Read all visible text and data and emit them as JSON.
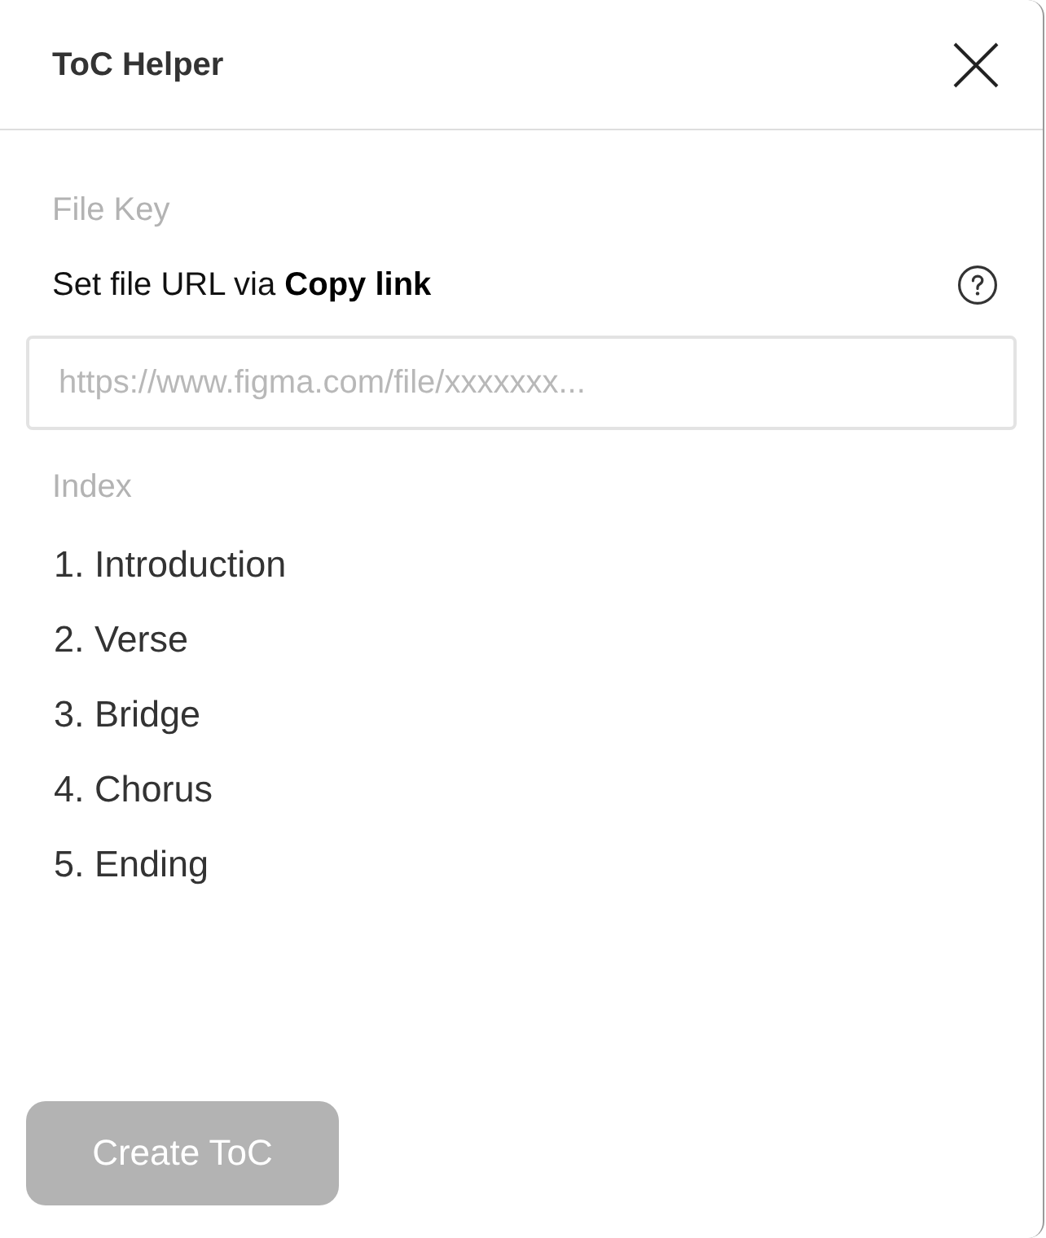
{
  "window": {
    "title": "ToC Helper"
  },
  "file_key": {
    "label": "File Key",
    "instruction": "Set file URL via **Copy link**",
    "url_field": {
      "placeholder": "https://www.figma.com/file/xxxxxxx..."
    }
  },
  "index": {
    "label": "Index",
    "items": [
      "1. Introduction",
      "2. Verse",
      "3. Bridge",
      "4. Chorus",
      "5. Ending"
    ]
  },
  "create_button": {
    "label": "Create ToC",
    "disabled": true
  }
}
